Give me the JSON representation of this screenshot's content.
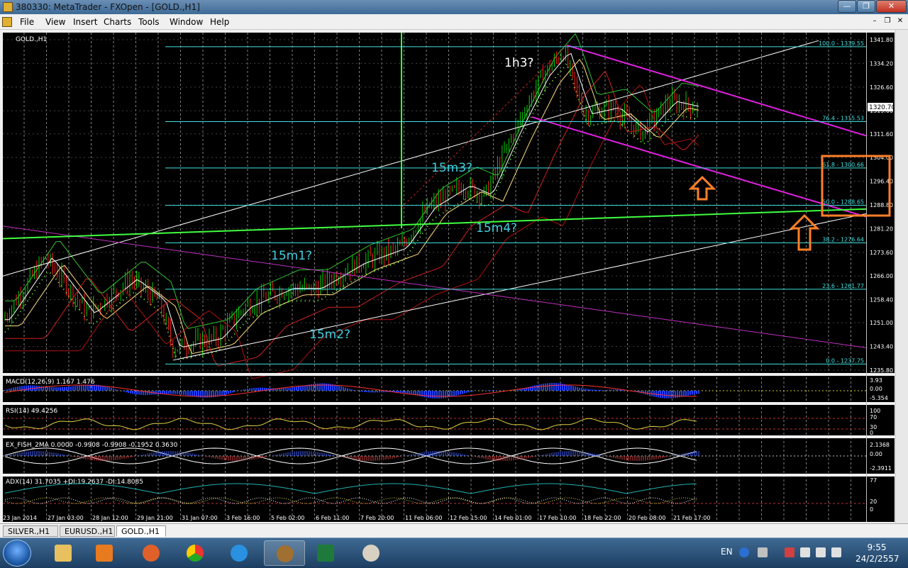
{
  "window": {
    "title": "380330: MetaTrader - FXOpen - [GOLD.,H1]",
    "controls": {
      "minimize": "—",
      "maximize": "❐",
      "close": "✕"
    }
  },
  "menu": [
    "File",
    "View",
    "Insert",
    "Charts",
    "Tools",
    "Window",
    "Help"
  ],
  "mdi_controls": [
    "–",
    "❐",
    "✕"
  ],
  "chart": {
    "symbol_label": "GOLD.,H1",
    "current_price": "1320.70",
    "price_ticks": [
      "1341.80",
      "1334.20",
      "1326.60",
      "1319.00",
      "1311.60",
      "1304.00",
      "1296.40",
      "1288.80",
      "1281.20",
      "1273.60",
      "1266.00",
      "1258.40",
      "1251.00",
      "1243.40",
      "1235.80"
    ],
    "fib_levels": [
      {
        "label": "100.0 - 1339.55",
        "price": 1339.55
      },
      {
        "label": "76.4 - 1315.53",
        "price": 1315.53
      },
      {
        "label": "61.8 - 1300.66",
        "price": 1300.66
      },
      {
        "label": "50.0 - 1288.65",
        "price": 1288.65
      },
      {
        "label": "38.2 - 1276.64",
        "price": 1276.64
      },
      {
        "label": "23.6 - 1261.77",
        "price": 1261.77
      },
      {
        "label": "0.0 - 1237.75",
        "price": 1237.75
      }
    ],
    "annotations": [
      "1h3?",
      "15m3?",
      "15m4?",
      "15m1?",
      "15m2?"
    ],
    "time_labels": [
      "23 Jan 2014",
      "27 Jan 03:00",
      "28 Jan 12:00",
      "29 Jan 21:00",
      "31 Jan 07:00",
      "3 Feb 16:00",
      "5 Feb 02:00",
      "6 Feb 11:00",
      "7 Feb 20:00",
      "11 Feb 06:00",
      "12 Feb 15:00",
      "14 Feb 01:00",
      "17 Feb 10:00",
      "18 Feb 22:00",
      "20 Feb 08:00",
      "21 Feb 17:00"
    ],
    "colors": {
      "background": "#000000",
      "fib": "#40e0e0",
      "channel": "#ffffff",
      "magenta": "#e020e0",
      "green": "#40ff40",
      "orange": "#ff7f27"
    }
  },
  "indicators": {
    "macd": {
      "label": "MACD(12,26,9) 1.167 1.476",
      "ticks": [
        "3.93",
        "0.00",
        "-5.354"
      ]
    },
    "rsi": {
      "label": "RSI(14) 49.4256",
      "ticks": [
        "100",
        "70",
        "30",
        "0"
      ]
    },
    "fisher": {
      "label": "EX_FISH_2MA 0.0000 -0.9908 -0.9908 -0.1952 0.3630",
      "ticks": [
        "2.1368",
        "0.00",
        "-2.3911"
      ]
    },
    "adx": {
      "label": "ADX(14) 31.7035 +DI:19.2637 -DI:14.8085",
      "ticks": [
        "77",
        "20",
        "0"
      ]
    }
  },
  "tabs": [
    {
      "label": "SILVER.,H1",
      "active": false
    },
    {
      "label": "EURUSD.,H1",
      "active": false
    },
    {
      "label": "GOLD.,H1",
      "active": true
    }
  ],
  "taskbar": {
    "apps": [
      "explorer-icon",
      "media-player-icon",
      "firefox-icon",
      "chrome-icon",
      "ie-icon",
      "metatrader-icon",
      "excel-icon",
      "paint-icon"
    ],
    "tray": {
      "language": "EN",
      "time": "9:55",
      "date": "24/2/2557"
    }
  }
}
